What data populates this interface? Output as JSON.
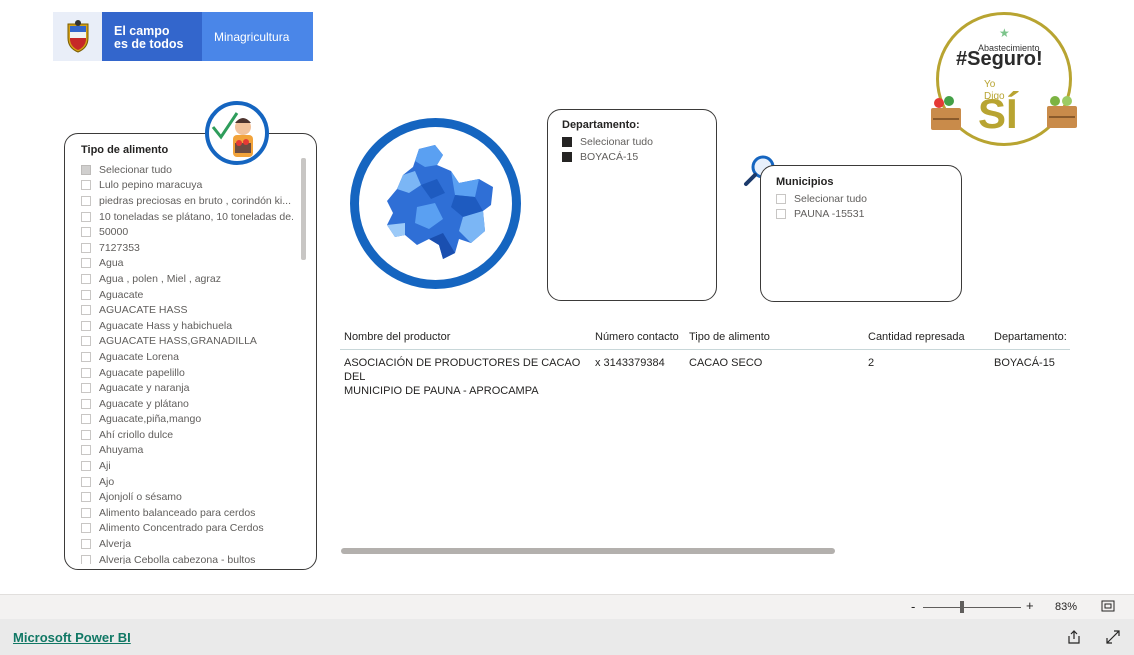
{
  "header": {
    "logo_line1": "El campo",
    "logo_line2": "es de todos",
    "ministry": "Minagricultura"
  },
  "badge": {
    "small_text": "Abastecimiento",
    "hashtag": "#Seguro!",
    "yo": "Yo",
    "digo": "Digo",
    "si": "SÍ"
  },
  "food_slicer": {
    "title": "Tipo de alimento",
    "items": [
      "Selecionar tudo",
      "Lulo pepino maracuya",
      "piedras preciosas en bruto , corindón ki...",
      "10 toneladas se plátano, 10 toneladas de...",
      "50000",
      "7127353",
      "Agua",
      "Agua , polen , Miel , agraz",
      "Aguacate",
      "AGUACATE HASS",
      "Aguacate Hass y habichuela",
      "AGUACATE HASS,GRANADILLA",
      "Aguacate Lorena",
      "Aguacate papelillo",
      "Aguacate y naranja",
      "Aguacate y plátano",
      "Aguacate,piña,mango",
      "Ahí criollo dulce",
      "Ahuyama",
      "Aji",
      "Ajo",
      "Ajonjolí o sésamo",
      "Alimento balanceado para cerdos",
      "Alimento Concentrado para Cerdos",
      "Alverja",
      "Alverja Cebolla cabezona - bultos"
    ]
  },
  "dep_slicer": {
    "title": "Departamento:",
    "items": [
      "Selecionar tudo",
      "BOYACÁ-15"
    ]
  },
  "mun_slicer": {
    "title": "Municipios",
    "items": [
      "Selecionar tudo",
      "PAUNA -15531"
    ]
  },
  "table": {
    "headers": [
      "Nombre del productor",
      "Número contacto",
      "Tipo de alimento",
      "Cantidad represada",
      "Departamento:"
    ],
    "row": {
      "productor_line1": "ASOCIACIÓN DE PRODUCTORES DE CACAO DEL",
      "productor_line2": "MUNICIPIO DE PAUNA - APROCAMPA",
      "contacto": "x 3143379384",
      "tipo": "CACAO SECO",
      "cantidad": "2",
      "departamento": "BOYACÁ-15"
    }
  },
  "zoom": {
    "minus": "-",
    "plus": "+",
    "level": "83%"
  },
  "footer": {
    "brand": "Microsoft Power BI"
  }
}
